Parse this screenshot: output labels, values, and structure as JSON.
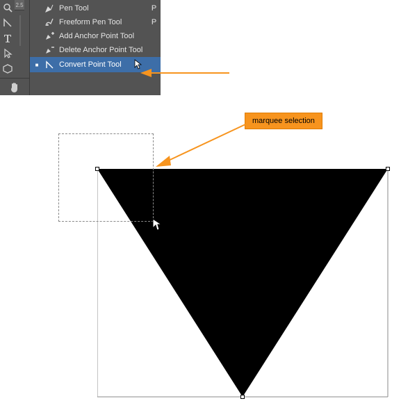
{
  "toolbar": {
    "tools": [
      {
        "name": "zoom",
        "icon": "magnifier"
      },
      {
        "name": "convert-point",
        "icon": "angle"
      },
      {
        "name": "type",
        "icon": "type"
      },
      {
        "name": "direct-selection",
        "icon": "hollow-arrow"
      },
      {
        "name": "shape",
        "icon": "hexagon"
      },
      {
        "name": "hand",
        "icon": "hand"
      }
    ],
    "ruler_label": "2.5"
  },
  "flyout": {
    "items": [
      {
        "label": "Pen Tool",
        "icon": "pen",
        "shortcut": "P",
        "checked": false
      },
      {
        "label": "Freeform Pen Tool",
        "icon": "freeform-pen",
        "shortcut": "P",
        "checked": false
      },
      {
        "label": "Add Anchor Point Tool",
        "icon": "pen-plus",
        "shortcut": "",
        "checked": false
      },
      {
        "label": "Delete Anchor Point Tool",
        "icon": "pen-minus",
        "shortcut": "",
        "checked": false
      },
      {
        "label": "Convert Point Tool",
        "icon": "angle",
        "shortcut": "",
        "checked": true,
        "selected": true
      }
    ]
  },
  "callouts": {
    "marquee": "marquee selection"
  },
  "colors": {
    "accent": "#f7941e",
    "panel": "#535353",
    "selection": "#3d6ea8"
  },
  "chart_data": null
}
